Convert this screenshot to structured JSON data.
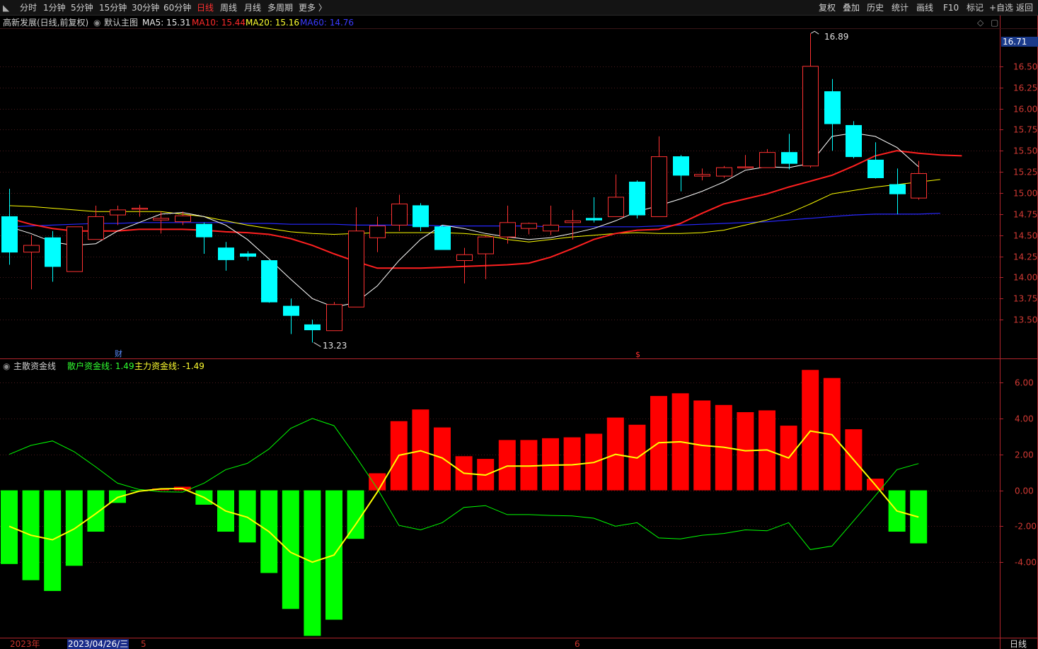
{
  "toolbar": {
    "left_items": [
      "分时",
      "1分钟",
      "5分钟",
      "15分钟",
      "30分钟",
      "60分钟",
      "日线",
      "周线",
      "月线",
      "多周期",
      "更多 〉"
    ],
    "active": "日线",
    "right_items": [
      "复权",
      "叠加",
      "历史",
      "统计",
      "画线",
      "F10",
      "标记",
      "+自选",
      "返回"
    ]
  },
  "main_panel": {
    "title": "高新发展(日线,前复权)",
    "indicator": "默认主图",
    "ma5_label": "MA5: 15.31",
    "ma10_label": "MA10: 15.44",
    "ma20_label": "MA20: 15.16",
    "ma60_label": "MA60: 14.76",
    "current_price": "16.71",
    "high_marker": "16.89",
    "low_marker": "13.23",
    "event_marker_cai": "财",
    "event_marker_s": "$"
  },
  "sub_panel": {
    "title": "主散资金线",
    "retail_label": "散户资金线: 1.49",
    "main_label": "主力资金线: -1.49"
  },
  "bottom_bar": {
    "year": "2023年",
    "cursor_date": "2023/04/26/三",
    "month5": "5",
    "month6": "6",
    "period": "日线"
  },
  "colors": {
    "up": "#ff3232",
    "down": "#00ffff",
    "ma5": "#ffffff",
    "ma10": "#ff2020",
    "ma20": "#ffff00",
    "ma60": "#2828ff",
    "retail": "#00ff00",
    "main": "#ffff00",
    "bar_pos": "#ff0000",
    "bar_neg": "#00ff00",
    "axis": "#b0242c"
  },
  "chart_data": [
    {
      "type": "candlestick",
      "title": "高新发展(日线,前复权)",
      "ylim": [
        13.1,
        16.95
      ],
      "y_ticks": [
        13.5,
        13.75,
        14.0,
        14.25,
        14.5,
        14.75,
        15.0,
        15.25,
        15.5,
        15.75,
        16.0,
        16.25,
        16.5
      ],
      "candles": [
        {
          "o": 14.72,
          "h": 15.05,
          "l": 14.15,
          "c": 14.3
        },
        {
          "o": 14.3,
          "h": 14.5,
          "l": 13.86,
          "c": 14.38
        },
        {
          "o": 14.47,
          "h": 14.55,
          "l": 13.95,
          "c": 14.13
        },
        {
          "o": 14.07,
          "h": 14.6,
          "l": 14.07,
          "c": 14.6
        },
        {
          "o": 14.45,
          "h": 14.85,
          "l": 14.45,
          "c": 14.72
        },
        {
          "o": 14.74,
          "h": 14.85,
          "l": 14.62,
          "c": 14.8
        },
        {
          "o": 14.82,
          "h": 14.86,
          "l": 14.72,
          "c": 14.82
        },
        {
          "o": 14.68,
          "h": 14.78,
          "l": 14.52,
          "c": 14.7
        },
        {
          "o": 14.66,
          "h": 14.78,
          "l": 14.62,
          "c": 14.73
        },
        {
          "o": 14.63,
          "h": 14.65,
          "l": 14.28,
          "c": 14.48
        },
        {
          "o": 14.35,
          "h": 14.42,
          "l": 14.08,
          "c": 14.21
        },
        {
          "o": 14.28,
          "h": 14.31,
          "l": 14.2,
          "c": 14.25
        },
        {
          "o": 14.2,
          "h": 14.2,
          "l": 13.7,
          "c": 13.71
        },
        {
          "o": 13.66,
          "h": 13.75,
          "l": 13.33,
          "c": 13.55
        },
        {
          "o": 13.44,
          "h": 13.5,
          "l": 13.23,
          "c": 13.38
        },
        {
          "o": 13.37,
          "h": 13.71,
          "l": 13.37,
          "c": 13.68
        },
        {
          "o": 13.65,
          "h": 14.83,
          "l": 13.65,
          "c": 14.55
        },
        {
          "o": 14.47,
          "h": 14.72,
          "l": 14.3,
          "c": 14.61
        },
        {
          "o": 14.62,
          "h": 14.98,
          "l": 14.55,
          "c": 14.87
        },
        {
          "o": 14.85,
          "h": 14.88,
          "l": 14.55,
          "c": 14.6
        },
        {
          "o": 14.6,
          "h": 14.62,
          "l": 14.35,
          "c": 14.33
        },
        {
          "o": 14.2,
          "h": 14.35,
          "l": 13.93,
          "c": 14.27
        },
        {
          "o": 14.28,
          "h": 14.5,
          "l": 13.98,
          "c": 14.48
        },
        {
          "o": 14.48,
          "h": 14.85,
          "l": 14.4,
          "c": 14.65
        },
        {
          "o": 14.58,
          "h": 14.65,
          "l": 14.51,
          "c": 14.64
        },
        {
          "o": 14.55,
          "h": 14.85,
          "l": 14.5,
          "c": 14.62
        },
        {
          "o": 14.65,
          "h": 14.8,
          "l": 14.45,
          "c": 14.67
        },
        {
          "o": 14.7,
          "h": 14.95,
          "l": 14.65,
          "c": 14.68
        },
        {
          "o": 14.72,
          "h": 15.22,
          "l": 14.72,
          "c": 14.95
        },
        {
          "o": 15.13,
          "h": 15.15,
          "l": 14.7,
          "c": 14.74
        },
        {
          "o": 14.72,
          "h": 15.67,
          "l": 14.72,
          "c": 15.43
        },
        {
          "o": 15.43,
          "h": 15.45,
          "l": 15.02,
          "c": 15.21
        },
        {
          "o": 15.2,
          "h": 15.29,
          "l": 15.15,
          "c": 15.22
        },
        {
          "o": 15.2,
          "h": 15.32,
          "l": 15.18,
          "c": 15.3
        },
        {
          "o": 15.3,
          "h": 15.45,
          "l": 15.29,
          "c": 15.31
        },
        {
          "o": 15.3,
          "h": 15.52,
          "l": 15.3,
          "c": 15.48
        },
        {
          "o": 15.48,
          "h": 15.7,
          "l": 15.28,
          "c": 15.35
        },
        {
          "o": 15.32,
          "h": 16.89,
          "l": 15.3,
          "c": 16.5
        },
        {
          "o": 16.2,
          "h": 16.35,
          "l": 15.5,
          "c": 15.82
        },
        {
          "o": 15.8,
          "h": 15.85,
          "l": 15.41,
          "c": 15.43
        },
        {
          "o": 15.39,
          "h": 15.6,
          "l": 15.17,
          "c": 15.18
        },
        {
          "o": 15.1,
          "h": 15.29,
          "l": 14.75,
          "c": 14.99
        },
        {
          "o": 14.94,
          "h": 15.38,
          "l": 14.92,
          "c": 15.23
        }
      ],
      "ma5": [
        14.6,
        14.52,
        14.42,
        14.38,
        14.4,
        14.55,
        14.65,
        14.75,
        14.77,
        14.72,
        14.62,
        14.45,
        14.22,
        13.98,
        13.75,
        13.65,
        13.7,
        13.9,
        14.2,
        14.45,
        14.62,
        14.58,
        14.52,
        14.48,
        14.45,
        14.47,
        14.52,
        14.58,
        14.67,
        14.78,
        14.85,
        14.93,
        15.02,
        15.13,
        15.27,
        15.31,
        15.3,
        15.35,
        15.67,
        15.71,
        15.67,
        15.54,
        15.31
      ],
      "ma10": [
        14.7,
        14.63,
        14.58,
        14.55,
        14.55,
        14.55,
        14.57,
        14.57,
        14.57,
        14.56,
        14.54,
        14.53,
        14.51,
        14.46,
        14.38,
        14.28,
        14.19,
        14.11,
        14.11,
        14.11,
        14.12,
        14.13,
        14.14,
        14.15,
        14.17,
        14.24,
        14.34,
        14.45,
        14.52,
        14.56,
        14.57,
        14.64,
        14.76,
        14.87,
        14.93,
        14.99,
        15.07,
        15.14,
        15.21,
        15.32,
        15.44,
        15.5,
        15.47,
        15.45,
        15.44
      ],
      "ma20": [
        14.85,
        14.84,
        14.82,
        14.8,
        14.78,
        14.78,
        14.78,
        14.78,
        14.75,
        14.72,
        14.67,
        14.62,
        14.58,
        14.54,
        14.52,
        14.51,
        14.52,
        14.53,
        14.53,
        14.53,
        14.53,
        14.52,
        14.5,
        14.45,
        14.42,
        14.45,
        14.48,
        14.5,
        14.52,
        14.53,
        14.52,
        14.52,
        14.53,
        14.56,
        14.62,
        14.68,
        14.76,
        14.87,
        14.99,
        15.03,
        15.07,
        15.1,
        15.13,
        15.16
      ],
      "ma60": [
        14.6,
        14.61,
        14.62,
        14.63,
        14.64,
        14.64,
        14.65,
        14.65,
        14.65,
        14.65,
        14.65,
        14.64,
        14.64,
        14.63,
        14.63,
        14.63,
        14.62,
        14.62,
        14.62,
        14.62,
        14.61,
        14.61,
        14.61,
        14.61,
        14.61,
        14.6,
        14.6,
        14.6,
        14.6,
        14.6,
        14.61,
        14.62,
        14.63,
        14.64,
        14.65,
        14.66,
        14.68,
        14.7,
        14.72,
        14.74,
        14.75,
        14.75,
        14.75,
        14.76
      ]
    },
    {
      "type": "bar",
      "title": "主散资金线",
      "ylim": [
        -8.2,
        7.3
      ],
      "y_ticks": [
        -4,
        -2,
        0,
        2,
        4,
        6
      ],
      "bars": [
        -4.1,
        -5.0,
        -5.6,
        -4.2,
        -2.3,
        -0.7,
        -0.05,
        0.1,
        0.2,
        -0.8,
        -2.3,
        -2.9,
        -4.6,
        -6.6,
        -8.1,
        -7.2,
        -2.7,
        0.95,
        3.85,
        4.5,
        3.5,
        1.9,
        1.75,
        2.8,
        2.8,
        2.9,
        2.95,
        3.15,
        4.05,
        3.65,
        5.25,
        5.4,
        5.0,
        4.75,
        4.35,
        4.45,
        3.6,
        6.7,
        6.25,
        3.4,
        0.65,
        -2.3,
        -2.95
      ],
      "series": [
        {
          "name": "散户资金线",
          "values": [
            2.0,
            2.5,
            2.75,
            2.15,
            1.3,
            0.4,
            0.05,
            -0.08,
            -0.1,
            0.4,
            1.15,
            1.5,
            2.3,
            3.45,
            4.0,
            3.6,
            1.9,
            0.1,
            -1.95,
            -2.2,
            -1.8,
            -0.95,
            -0.85,
            -1.35,
            -1.35,
            -1.4,
            -1.42,
            -1.55,
            -2.0,
            -1.8,
            -2.65,
            -2.7,
            -2.5,
            -2.4,
            -2.2,
            -2.25,
            -1.8,
            -3.3,
            -3.1,
            -1.7,
            -0.3,
            1.15,
            1.49
          ]
        },
        {
          "name": "主力资金线",
          "values": [
            -2.0,
            -2.5,
            -2.75,
            -2.15,
            -1.3,
            -0.4,
            -0.05,
            0.08,
            0.1,
            -0.4,
            -1.15,
            -1.5,
            -2.3,
            -3.45,
            -4.0,
            -3.6,
            -1.9,
            -0.1,
            1.95,
            2.2,
            1.8,
            0.95,
            0.85,
            1.35,
            1.35,
            1.4,
            1.42,
            1.55,
            2.0,
            1.8,
            2.65,
            2.7,
            2.5,
            2.4,
            2.2,
            2.25,
            1.8,
            3.3,
            3.1,
            1.7,
            0.3,
            -1.15,
            -1.49
          ]
        }
      ]
    }
  ]
}
